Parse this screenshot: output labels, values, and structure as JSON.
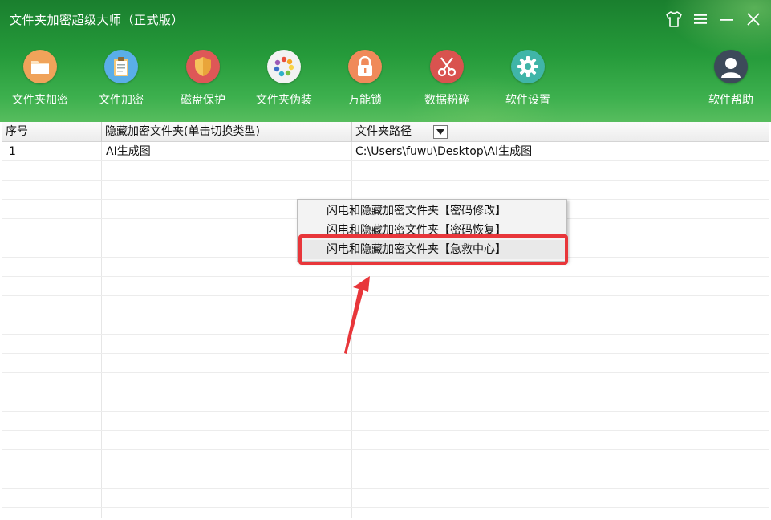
{
  "window": {
    "title": "文件夹加密超级大师（正式版）",
    "controls": [
      "skin-icon",
      "menu-icon",
      "minimize-icon",
      "close-icon"
    ]
  },
  "toolbar": {
    "items": [
      {
        "label": "文件夹加密",
        "icon": "folder-icon",
        "color": "#f0a35a"
      },
      {
        "label": "文件加密",
        "icon": "clipboard-icon",
        "color": "#5aaee8"
      },
      {
        "label": "磁盘保护",
        "icon": "shield-icon",
        "color": "#de5757"
      },
      {
        "label": "文件夹伪装",
        "icon": "color-wheel-icon",
        "color": "#f2f2f2"
      },
      {
        "label": "万能锁",
        "icon": "lock-icon",
        "color": "#f08a5a"
      },
      {
        "label": "数据粉碎",
        "icon": "scissors-icon",
        "color": "#d9534f"
      },
      {
        "label": "软件设置",
        "icon": "gear-icon",
        "color": "#40b5a8"
      },
      {
        "label": "软件帮助",
        "icon": "user-icon",
        "color": "#3d4a5a"
      }
    ]
  },
  "table": {
    "columns": [
      "序号",
      "隐藏加密文件夹(单击切换类型)",
      "文件夹路径"
    ],
    "rows": [
      {
        "index": "1",
        "name": "AI生成图",
        "path": "C:\\Users\\fuwu\\Desktop\\AI生成图"
      }
    ]
  },
  "context_menu": {
    "items": [
      "闪电和隐藏加密文件夹【密码修改】",
      "闪电和隐藏加密文件夹【密码恢复】",
      "闪电和隐藏加密文件夹【急救中心】"
    ],
    "highlight_color": "#e8363a"
  }
}
